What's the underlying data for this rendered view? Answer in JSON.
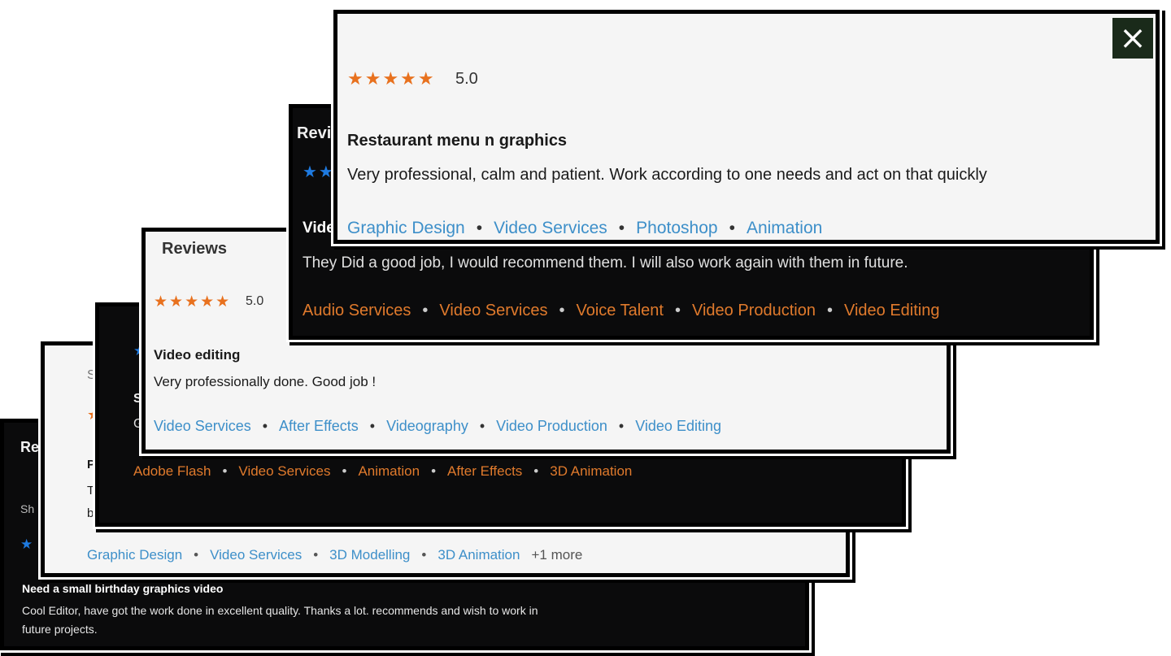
{
  "card1": {
    "title": "Re",
    "shown_text": "Sh",
    "review_title": "Need a small birthday graphics video",
    "review_body_1": "Cool Editor, have got the work done in excellent quality. Thanks a lot. recommends and wish to work in",
    "review_body_2": "future projects."
  },
  "card2": {
    "fragment_s": "S",
    "fragment_p": "P",
    "fragment_t": "T",
    "fragment_b": "b",
    "tags": [
      "Graphic Design",
      "Video Services",
      "3D Modelling",
      "3D Animation"
    ],
    "more": "+1 more"
  },
  "card3": {
    "fragment_s": "S",
    "fragment_g": "G",
    "tags": [
      "Adobe Flash",
      "Video Services",
      "Animation",
      "After Effects",
      "3D Animation"
    ]
  },
  "card4": {
    "heading": "Reviews",
    "rating": "5.0",
    "review_title": "Video editing",
    "review_body": "Very professionally done. Good job !",
    "tags": [
      "Video Services",
      "After Effects",
      "Videography",
      "Video Production",
      "Video Editing"
    ]
  },
  "card5": {
    "heading": "Revi",
    "review_title": "Vide",
    "review_body": "They Did a good job, I would recommend them. I will also work again with them in future.",
    "tags": [
      "Audio Services",
      "Video Services",
      "Voice Talent",
      "Video Production",
      "Video Editing"
    ]
  },
  "card6": {
    "rating": "5.0",
    "review_title": "Restaurant menu n graphics",
    "review_body": "Very professional, calm and patient. Work according to one needs and act on that quickly",
    "tags": [
      "Graphic Design",
      "Video Services",
      "Photoshop",
      "Animation"
    ],
    "close_label": "×"
  },
  "colors": {
    "star_orange": "#e8711e",
    "star_blue": "#1e7ae0",
    "tag_orange": "#e07a2c",
    "tag_blue": "#3d8fc9",
    "dark_bg": "#0b0b0c",
    "light_bg": "#f5f5f5"
  }
}
